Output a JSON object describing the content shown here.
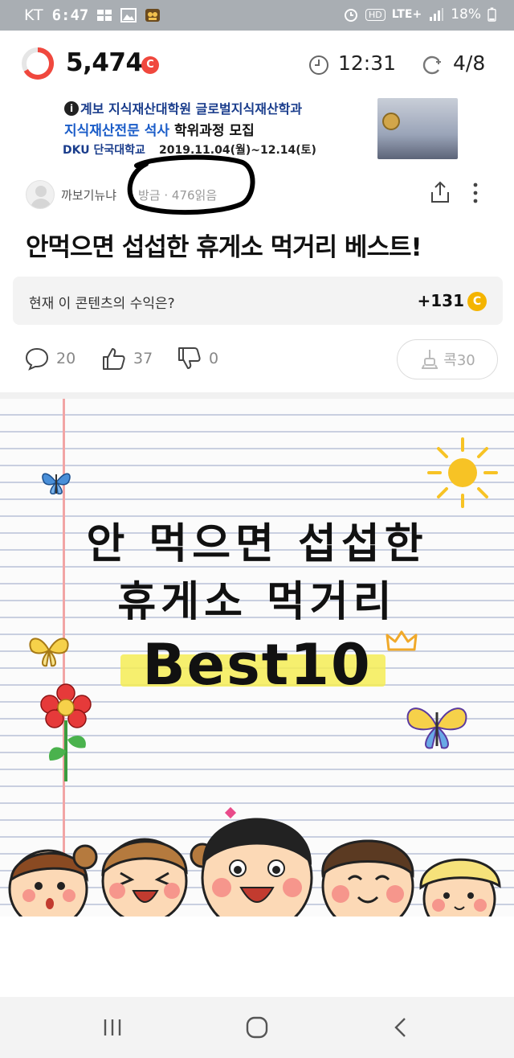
{
  "status_bar": {
    "carrier": "KT",
    "time": "6:47",
    "network": "LTE+",
    "hd_label": "HD",
    "battery": "18%"
  },
  "top_bar": {
    "points": "5,474",
    "points_coin": "C",
    "timer": "12:31",
    "progress": "4/8"
  },
  "banner_ad": {
    "line1": "계보 지식재산대학원 글로벌지식재산학과",
    "line2_highlight": "지식재산전문 석사",
    "line2_rest": "학위과정 모집",
    "logo": "DKU 단국대학교",
    "dates": "2019.11.04(월)~12.14(토)",
    "info_mark": "i"
  },
  "article": {
    "author": "까보기뉴냐",
    "posted": "방금",
    "reads": "476읽음",
    "title": "안먹으면 섭섭한 휴게소 먹거리 베스트!",
    "revenue_label": "현재 이 콘텐츠의 수익은?",
    "revenue_amount": "+131",
    "revenue_coin": "C",
    "comments": "20",
    "likes": "37",
    "dislikes": "0",
    "kok_label": "콕30"
  },
  "hero_image": {
    "line1": "안 먹으면 섭섭한",
    "line2": "휴게소 먹거리",
    "line3": "Best10"
  },
  "colors": {
    "accent_red": "#f0483e",
    "coin_yellow": "#f4b400",
    "status_bar": "#a9aeb3"
  }
}
